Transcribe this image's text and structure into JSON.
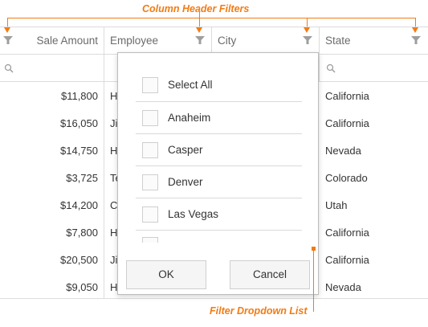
{
  "callouts": {
    "header_filters": "Column Header Filters",
    "dropdown_list": "Filter Dropdown List"
  },
  "grid": {
    "columns": [
      {
        "label": "Sale Amount"
      },
      {
        "label": "Employee"
      },
      {
        "label": "City"
      },
      {
        "label": "State"
      }
    ],
    "rows": [
      {
        "amount": "$11,800",
        "employee": "H",
        "state": "California"
      },
      {
        "amount": "$16,050",
        "employee": "Ji",
        "state": "California"
      },
      {
        "amount": "$14,750",
        "employee": "H",
        "state": "Nevada"
      },
      {
        "amount": "$3,725",
        "employee": "Te",
        "state": "Colorado"
      },
      {
        "amount": "$14,200",
        "employee": "C",
        "state": "Utah"
      },
      {
        "amount": "$7,800",
        "employee": "H",
        "state": "California"
      },
      {
        "amount": "$20,500",
        "employee": "Ji",
        "state": "California"
      },
      {
        "amount": "$9,050",
        "employee": "H",
        "state": "Nevada"
      }
    ]
  },
  "dropdown": {
    "items": [
      {
        "label": "Select All"
      },
      {
        "label": "Anaheim"
      },
      {
        "label": "Casper"
      },
      {
        "label": "Denver"
      },
      {
        "label": "Las Vegas"
      }
    ],
    "ok_label": "OK",
    "cancel_label": "Cancel"
  },
  "icons": {
    "filter": "funnel-icon",
    "search": "search-icon"
  },
  "colors": {
    "accent": "#f27b14",
    "border": "#dcdcdc",
    "icon": "#9e9e9e"
  }
}
